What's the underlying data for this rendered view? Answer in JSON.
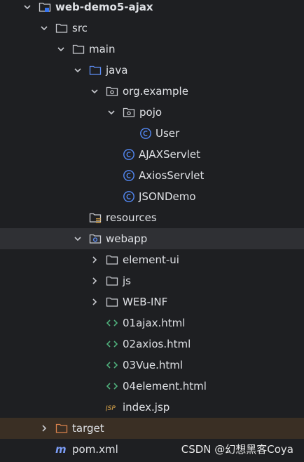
{
  "project_tree": {
    "root": "web-demo5-ajax",
    "src": "src",
    "main": "main",
    "java": "java",
    "package": "org.example",
    "pojo": "pojo",
    "user_class": "User",
    "ajax_servlet": "AJAXServlet",
    "axios_servlet": "AxiosServlet",
    "json_demo": "JSONDemo",
    "resources": "resources",
    "webapp": "webapp",
    "element_ui": "element-ui",
    "js": "js",
    "web_inf": "WEB-INF",
    "file_01": "01ajax.html",
    "file_02": "02axios.html",
    "file_03": "03Vue.html",
    "file_04": "04element.html",
    "index_jsp": "index.jsp",
    "target": "target",
    "pom": "pom.xml"
  },
  "watermark": "CSDN @幻想黑客Coya",
  "colors": {
    "background": "#1e1f22",
    "selected_row": "#2f3034",
    "excluded_row": "#3a2f24",
    "class_icon": "#548af7",
    "html_icon": "#4faf7b",
    "maven_icon": "#7b9cf5"
  }
}
